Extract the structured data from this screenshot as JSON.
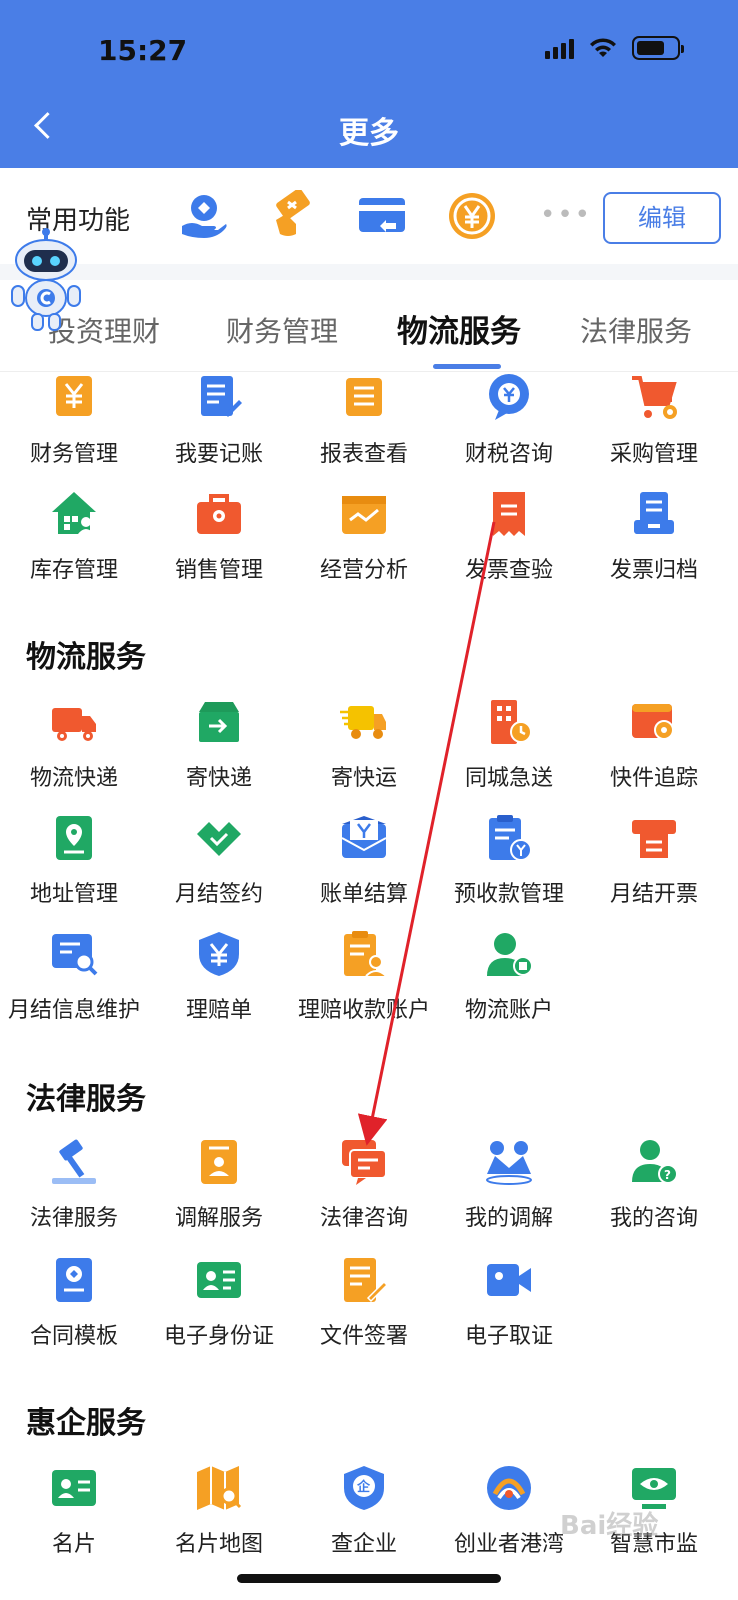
{
  "status": {
    "time": "15:27"
  },
  "header": {
    "title": "更多"
  },
  "common": {
    "label": "常用功能",
    "dots": "•••",
    "edit_label": "编辑"
  },
  "tabs": [
    "投资理财",
    "财务管理",
    "物流服务",
    "法律服务"
  ],
  "finance_rows": [
    [
      "财务管理",
      "我要记账",
      "报表查看",
      "财税咨询",
      "采购管理"
    ],
    [
      "库存管理",
      "销售管理",
      "经营分析",
      "发票查验",
      "发票归档"
    ]
  ],
  "sections": {
    "logistics": {
      "title": "物流服务",
      "rows": [
        [
          "物流快递",
          "寄快递",
          "寄快运",
          "同城急送",
          "快件追踪"
        ],
        [
          "地址管理",
          "月结签约",
          "账单结算",
          "预收款管理",
          "月结开票"
        ],
        [
          "月结信息维护",
          "理赔单",
          "理赔收款账户",
          "物流账户"
        ]
      ]
    },
    "legal": {
      "title": "法律服务",
      "rows": [
        [
          "法律服务",
          "调解服务",
          "法律咨询",
          "我的调解",
          "我的咨询"
        ],
        [
          "合同模板",
          "电子身份证",
          "文件签署",
          "电子取证"
        ]
      ]
    },
    "benefit": {
      "title": "惠企服务",
      "rows": [
        [
          "名片",
          "名片地图",
          "查企业",
          "创业者港湾",
          "智慧市监"
        ]
      ]
    }
  },
  "colors": {
    "header": "#4a7ee6",
    "orange": "#f5a024",
    "red": "#f0592f",
    "green": "#20a864",
    "blue": "#3d7bea",
    "annotation": "#e0222a"
  },
  "watermark": "Bai经验"
}
